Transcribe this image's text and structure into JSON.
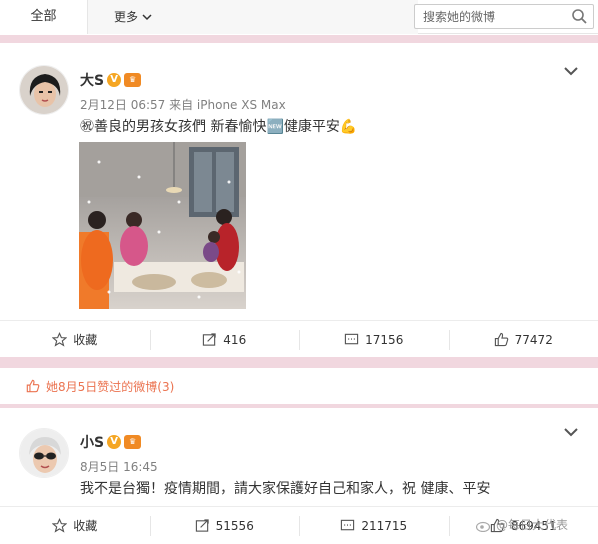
{
  "tabs": {
    "all": "全部",
    "more": "更多"
  },
  "search": {
    "placeholder": "搜索她的微博"
  },
  "post1": {
    "author": "大S",
    "verified_badge": "V",
    "meta": "2月12日 06:57 来自 iPhone XS Max",
    "text": "㊗善良的男孩女孩們 新春愉快🆕健康平安💪",
    "actions": {
      "favorite": "收藏",
      "repost": "416",
      "comment": "17156",
      "like": "77472"
    }
  },
  "liked_section": {
    "label": "她8月5日赞过的微博(3)"
  },
  "post2": {
    "author": "小S",
    "verified_badge": "V",
    "meta": "8月5日 16:45",
    "text": "我不是台獨！疫情期間，請大家保護好自己和家人，祝 健康、平安",
    "actions": {
      "favorite": "收藏",
      "repost": "51556",
      "comment": "211715",
      "like": "869451"
    }
  },
  "watermark": "@每日大代表",
  "colors": {
    "accent_orange": "#eb7350",
    "pink_separator": "#f1d7df",
    "badge_gold": "#f5a623"
  }
}
